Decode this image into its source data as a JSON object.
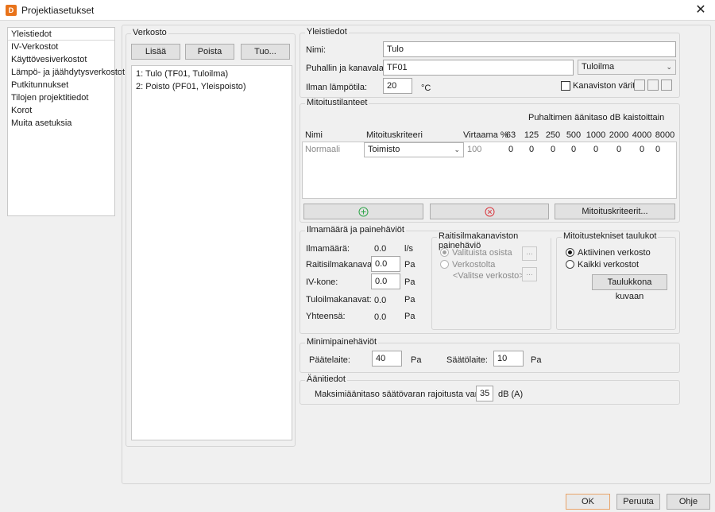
{
  "window": {
    "title": "Projektiasetukset",
    "icon_letter": "D"
  },
  "nav": {
    "items": [
      "Yleistiedot",
      "IV-Verkostot",
      "Käyttövesiverkostot",
      "Lämpö- ja jäähdytysverkostot",
      "Putkitunnukset",
      "Tilojen projektitiedot",
      "Korot",
      "Muita asetuksia"
    ]
  },
  "verkosto": {
    "title": "Verkosto",
    "add_label": "Lisää",
    "remove_label": "Poista",
    "import_label": "Tuo...",
    "items": [
      "1: Tulo (TF01, Tuloilma)",
      "2: Poisto (PF01, Yleispoisto)"
    ]
  },
  "yleistiedot": {
    "title": "Yleistiedot",
    "name_label": "Nimi:",
    "name_value": "Tulo",
    "fan_label": "Puhallin ja kanavalaji:",
    "fan_value": "TF01",
    "fan_type": "Tuloilma",
    "temp_label": "Ilman lämpötila:",
    "temp_value": "20",
    "temp_unit": "°C",
    "colors_label": "Kanaviston värit"
  },
  "mitoitus": {
    "title": "Mitoitustilanteet",
    "fan_noise_header": "Puhaltimen äänitaso dB kaistoittain",
    "col_name": "Nimi",
    "col_criteria": "Mitoituskriteeri",
    "col_flow": "Virtaama %",
    "bands": [
      "63",
      "125",
      "250",
      "500",
      "1000",
      "2000",
      "4000",
      "8000"
    ],
    "row": {
      "name": "Normaali",
      "criteria": "Toimisto",
      "flow": "100",
      "values": [
        "0",
        "0",
        "0",
        "0",
        "0",
        "0",
        "0",
        "0"
      ]
    },
    "criteria_button": "Mitoituskriteerit..."
  },
  "ilmamaara": {
    "title": "Ilmamäärä ja painehäviöt",
    "rows": [
      {
        "label": "Ilmamäärä:",
        "value": "0.0",
        "unit": "l/s",
        "editable": false
      },
      {
        "label": "Raitisilmakanavat:",
        "value": "0.0",
        "unit": "Pa",
        "editable": true
      },
      {
        "label": "IV-kone:",
        "value": "0.0",
        "unit": "Pa",
        "editable": true
      },
      {
        "label": "Tuloilmakanavat:",
        "value": "0.0",
        "unit": "Pa",
        "editable": false
      },
      {
        "label": "Yhteensä:",
        "value": "0.0",
        "unit": "Pa",
        "editable": false
      }
    ]
  },
  "raitisilma": {
    "title": "Raitisilmakanaviston painehäviö",
    "option1": "Valituista osista",
    "option2": "Verkostolta",
    "network_placeholder": "<Valitse verkosto>",
    "dots": "..."
  },
  "taulukot": {
    "title": "Mitoitustekniset taulukot",
    "option1": "Aktiivinen verkosto",
    "option2": "Kaikki verkostot",
    "button": "Taulukkona kuvaan"
  },
  "minimi": {
    "title": "Minimipainehäviöt",
    "terminal_label": "Päätelaite:",
    "terminal_value": "40",
    "terminal_unit": "Pa",
    "damper_label": "Säätölaite:",
    "damper_value": "10",
    "damper_unit": "Pa"
  },
  "aani": {
    "title": "Äänitiedot",
    "label": "Maksimiäänitaso säätövaran rajoitusta varten:",
    "value": "35",
    "unit": "dB (A)"
  },
  "footer": {
    "ok": "OK",
    "cancel": "Peruuta",
    "help": "Ohje"
  },
  "colors": {
    "accent_orange": "#e8731a",
    "add_green": "#2fa64a",
    "remove_red": "#d9363e"
  }
}
